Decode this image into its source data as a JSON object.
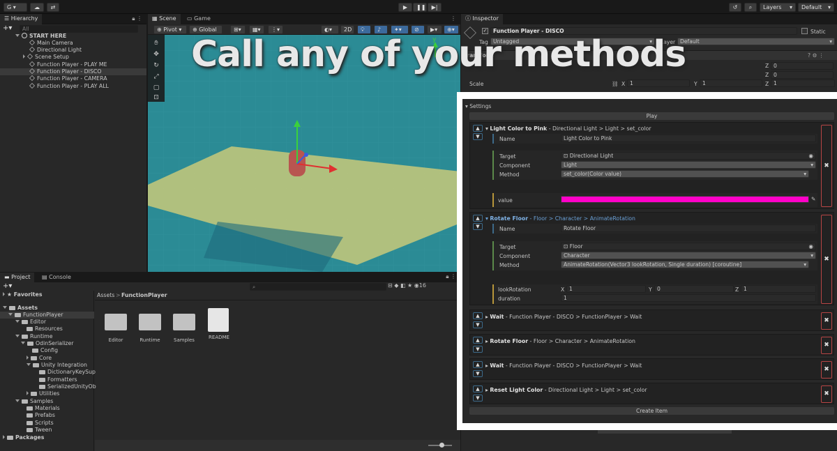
{
  "topbar": {
    "account": "G",
    "layers": "Layers",
    "layout": "Default"
  },
  "hierarchy": {
    "tab": "Hierarchy",
    "search_placeholder": "All",
    "root": "START HERE",
    "items": [
      "Main Camera",
      "Directional Light",
      "Scene Setup",
      "Function Player - PLAY ME",
      "Function Player - DISCO",
      "Function Player - CAMERA",
      "Function Player - PLAY ALL"
    ]
  },
  "scene": {
    "tabs": [
      "Scene",
      "Game"
    ],
    "pivot": "Pivot",
    "global": "Global",
    "mode2d": "2D",
    "axis_y": "y",
    "headline": "Call any of your methods"
  },
  "project": {
    "tabs": [
      "Project",
      "Console"
    ],
    "favorites": "Favorites",
    "assets": "Assets",
    "tree": [
      "FunctionPlayer",
      "Editor",
      "Resources",
      "Runtime",
      "OdinSerializer",
      "Config",
      "Core",
      "Unity Integration",
      "DictionaryKeySup",
      "Formatters",
      "SerializedUnityOb",
      "Utilities",
      "Samples",
      "Materials",
      "Prefabs",
      "Scripts",
      "Tween",
      "Packages"
    ],
    "breadcrumb": [
      "Assets",
      "FunctionPlayer"
    ],
    "files": [
      "Editor",
      "Runtime",
      "Samples",
      "README"
    ],
    "count": "16"
  },
  "inspector": {
    "tab": "Inspector",
    "object_name": "Function Player - DISCO",
    "static": "Static",
    "tag_label": "Tag",
    "tag_value": "Untagged",
    "layer_label": "Layer",
    "layer_value": "Default",
    "transform": "Transform",
    "scale_label": "Scale",
    "scale": {
      "x": "1",
      "y": "1",
      "z": "1"
    },
    "pos_z": "0",
    "rot_z": "0",
    "axis": {
      "x": "X",
      "y": "Y",
      "z": "Z"
    }
  },
  "settings": {
    "label": "Settings",
    "play": "Play",
    "create": "Create Item",
    "items": [
      {
        "title": "Light Color to Pink",
        "path": "Directional Light > Light > set_color",
        "name_label": "Name",
        "name": "Light Color to Pink",
        "target_label": "Target",
        "target": "Directional Light",
        "component_label": "Component",
        "component": "Light",
        "method_label": "Method",
        "method": "set_color(Color value)",
        "param": "value",
        "color": "#ff00c8"
      },
      {
        "title": "Rotate Floor",
        "path": "Floor > Character > AnimateRotation",
        "name_label": "Name",
        "name": "Rotate Floor",
        "target_label": "Target",
        "target": "Floor",
        "component_label": "Component",
        "component": "Character",
        "method_label": "Method",
        "method": "AnimateRotation(Vector3 lookRotation, Single duration) [coroutine]",
        "param1": "lookRotation",
        "vx": "1",
        "vy": "0",
        "vz": "1",
        "param2": "duration",
        "duration": "1"
      },
      {
        "title": "Wait",
        "path": "Function Player - DISCO > FunctionPlayer > Wait"
      },
      {
        "title": "Rotate Floor",
        "path": "Floor > Character > AnimateRotation"
      },
      {
        "title": "Wait",
        "path": "Function Player - DISCO > FunctionPlayer > Wait"
      },
      {
        "title": "Reset Light Color",
        "path": "Directional Light > Light > set_color"
      }
    ]
  },
  "colors": {
    "scene_bg": "#2b8b95",
    "floor": "#c8c97a",
    "accent_blue": "#3d6a8a",
    "remove_red": "#b84545",
    "pink": "#ff00c8"
  }
}
